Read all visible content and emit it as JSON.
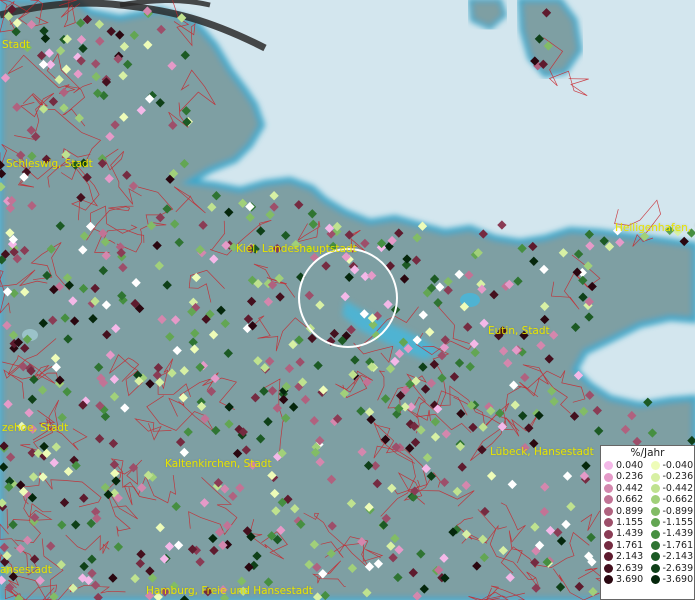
{
  "map": {
    "colors": {
      "water": "#d3e6ee",
      "land": "#7e9fa3",
      "shore": "#3fa7c9",
      "boundary": "#c8252b",
      "label": "#e8e400",
      "selection_ring": "#ffffff"
    },
    "cities": [
      {
        "id": "city-schleswig",
        "name": "Schleswig, Stadt"
      },
      {
        "id": "city-kiel",
        "name": "Kiel, Landeshauptstadt"
      },
      {
        "id": "city-heiligenhafen",
        "name": "Heiligenhafen, Stadt"
      },
      {
        "id": "city-eutin",
        "name": "Eutin, Stadt"
      },
      {
        "id": "city-itzehoe",
        "name": "zehoe, Stadt"
      },
      {
        "id": "city-kaltenkirchen",
        "name": "Kaltenkirchen, Stadt"
      },
      {
        "id": "city-luebeck",
        "name": "Lübeck, Hansestadt"
      },
      {
        "id": "city-hamburg",
        "name": "Hamburg, Freie und Hansestadt"
      },
      {
        "id": "city-flensburg",
        "name": "Stadt"
      },
      {
        "id": "city-west-hanse",
        "name": "ansestadt"
      }
    ]
  },
  "legend": {
    "title": "%/Jahr",
    "positive": [
      {
        "label": "0.040",
        "color": "#f4b8e8"
      },
      {
        "label": "0.236",
        "color": "#e59ac8"
      },
      {
        "label": "0.442",
        "color": "#d487ad"
      },
      {
        "label": "0.662",
        "color": "#c27395"
      },
      {
        "label": "0.899",
        "color": "#b0627f"
      },
      {
        "label": "1.155",
        "color": "#9d4f6a"
      },
      {
        "label": "1.439",
        "color": "#8a3c55"
      },
      {
        "label": "1.761",
        "color": "#752b41"
      },
      {
        "label": "2.143",
        "color": "#5e1b2e"
      },
      {
        "label": "2.639",
        "color": "#44101e"
      },
      {
        "label": "3.690",
        "color": "#2a0710"
      }
    ],
    "negative": [
      {
        "label": "-0.040",
        "color": "#eefcb8"
      },
      {
        "label": "-0.236",
        "color": "#d7f0a4"
      },
      {
        "label": "-0.442",
        "color": "#bfe28f"
      },
      {
        "label": "-0.662",
        "color": "#a1d07a"
      },
      {
        "label": "-0.899",
        "color": "#82bc66"
      },
      {
        "label": "-1.155",
        "color": "#63a653"
      },
      {
        "label": "-1.439",
        "color": "#468f41"
      },
      {
        "label": "-1.761",
        "color": "#2f7432"
      },
      {
        "label": "-2.143",
        "color": "#1c5a24"
      },
      {
        "label": "-2.639",
        "color": "#0f4018"
      },
      {
        "label": "-3.690",
        "color": "#05270c"
      }
    ]
  }
}
